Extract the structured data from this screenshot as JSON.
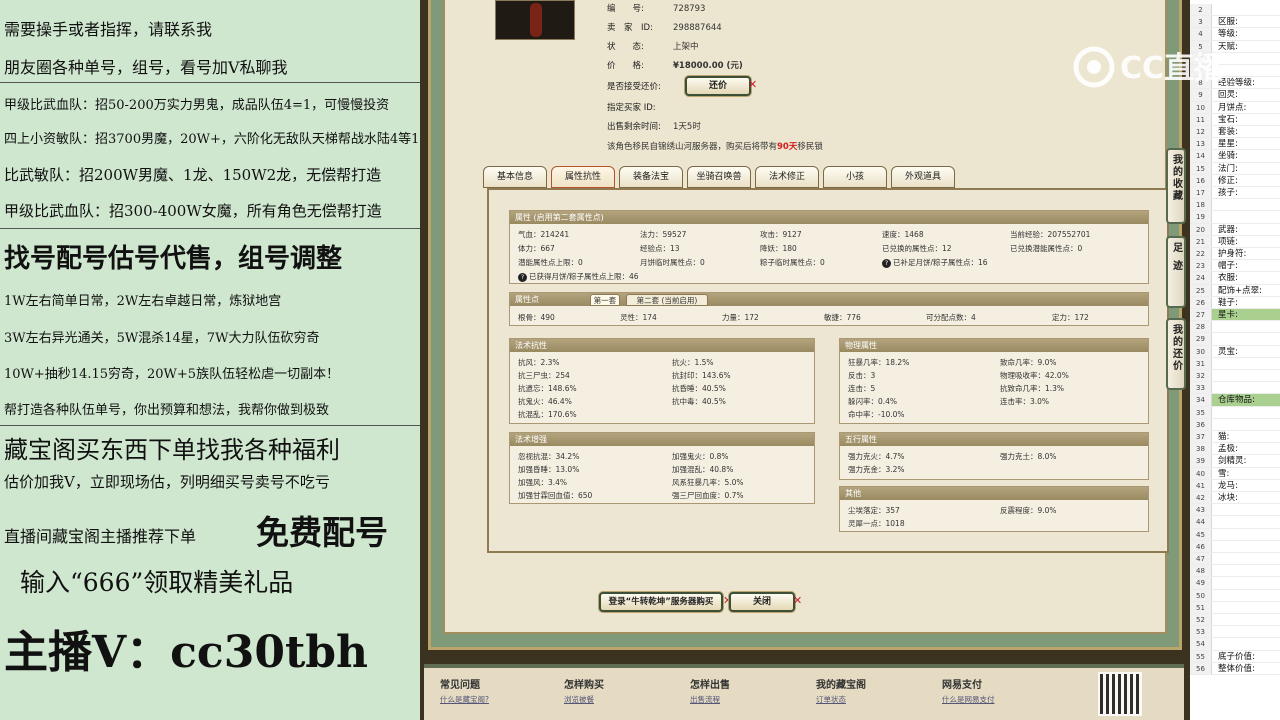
{
  "promo": {
    "lines": [
      "需要操手或者指挥，请联系我",
      "朋友圈各种单号，组号，看号加Ⅴ私聊我",
      "甲级比武血队：招50-200万实力男鬼，成品队伍4=1，可慢慢投资",
      "四上小资敏队：招3700男魔，20W+，六阶化无敌队天梯帮战水陆4等1",
      "比武敏队：招200W男魔、1龙、150W2龙，无偿帮打造",
      "甲级比武血队：招300-400W女魔，所有角色无偿帮打造",
      "找号配号估号代售，组号调整",
      "1W左右简单日常，2W左右卓越日常，炼狱地宫",
      "3W左右异光通关，5W混杀14星，7W大力队伍砍穷奇",
      "10W+抽秒14.15穷奇，20W+5族队伍轻松虐一切副本！",
      "帮打造各种队伍单号，你出预算和想法，我帮你做到极致",
      "藏宝阁买东西下单找我各种福利",
      "估价加我Ⅴ，立即现场估，列明细买号卖号不吃亏",
      "直播间藏宝阁主播推荐下单",
      "免费配号",
      "输入“666”领取精美礼品",
      "主播Ⅴ：cc30tbh"
    ]
  },
  "listing": {
    "rows": [
      {
        "label": "编　　号:",
        "value": "728793"
      },
      {
        "label": "卖　家　ID:",
        "value": "298887644"
      },
      {
        "label": "状　　态:",
        "value": "上架中"
      },
      {
        "label": "价　　格:",
        "value": "¥18000.00 (元)"
      },
      {
        "label": "是否接受还价:",
        "value": ""
      },
      {
        "label": "指定买家 ID:",
        "value": ""
      },
      {
        "label": "出售剩余时间:",
        "value": "1天5时"
      }
    ],
    "counter_offer_button": "还价",
    "notice_prefix": "该角色移民自锦绣山河服务器，购买后将带有",
    "notice_days": "90天",
    "notice_suffix": "移民锁"
  },
  "tabs": [
    "基本信息",
    "属性抗性",
    "装备法宝",
    "坐骑召唤兽",
    "法术修正",
    "小孩",
    "外观道具"
  ],
  "attrs": {
    "title": "属性 (启用第二套属性点)",
    "cells": [
      "气血：214241",
      "法力：59527",
      "攻击：9127",
      "速度：1468",
      "当前经验：207552701",
      "体力：667",
      "经验点：13",
      "降妖：180",
      "已兑换的属性点：12",
      "已兑换潜能属性点：0",
      "潜能属性点上限：0",
      "月饼临时属性点：0",
      "粽子临时属性点：0",
      "已补足月饼/粽子属性点：16",
      "已获得月饼/粽子属性点上限：46"
    ]
  },
  "points": {
    "title": "属性点",
    "tab1": "第一套",
    "tab2": "第二套 (当前启用)",
    "cells": [
      "根骨：490",
      "灵性：174",
      "力量：172",
      "敏捷：776",
      "可分配点数：4",
      "定力：172"
    ]
  },
  "resist": {
    "title": "法术抗性",
    "cells": [
      "抗风：2.3%",
      "抗火：1.5%",
      "抗三尸虫：254",
      "抗封印：143.6%",
      "抗遗忘：148.6%",
      "抗昏睡：40.5%",
      "抗鬼火：46.4%",
      "抗中毒：40.5%",
      "抗混乱：170.6%"
    ]
  },
  "enhance": {
    "title": "法术增强",
    "cells": [
      "忽视抗混：34.2%",
      "加强鬼火：0.8%",
      "加强昏睡：13.0%",
      "加强混乱：40.8%",
      "加强风：3.4%",
      "风系狂暴几率：5.0%",
      "加强甘霖回血值：650",
      "强三尸回血度：0.7%"
    ]
  },
  "physical": {
    "title": "物理属性",
    "cells": [
      "狂暴几率：18.2%",
      "致命几率：9.0%",
      "反击：3",
      "物理吸收率：42.0%",
      "连击：5",
      "抗致命几率：1.3%",
      "躲闪率：0.4%",
      "连击率：3.0%",
      "命中率：-10.0%"
    ]
  },
  "wuxing": {
    "title": "五行属性",
    "cells": [
      "强力克火：4.7%",
      "强力克土：8.0%",
      "强力克金：3.2%"
    ]
  },
  "other": {
    "title": "其他",
    "cells": [
      "尘埃落定：357",
      "反震程度：9.0%",
      "灵犀一点：1018"
    ]
  },
  "actions": {
    "buy": "登录“牛转乾坤”服务器购买",
    "close": "关闭"
  },
  "side_tabs": [
    "我的收藏",
    "足迹",
    "我的还价"
  ],
  "footer": {
    "cols": [
      {
        "title": "常见问题",
        "link": "什么是藏宝阁?"
      },
      {
        "title": "怎样购买",
        "link": "浏览被餐"
      },
      {
        "title": "怎样出售",
        "link": "出售流程"
      },
      {
        "title": "我的藏宝阁",
        "link": "订单状态"
      },
      {
        "title": "网易支付",
        "link": "什么是网易支付"
      }
    ]
  },
  "watermark": "CC直播",
  "sheet": {
    "rows": [
      {
        "n": "2",
        "v": ""
      },
      {
        "n": "3",
        "v": "区服:"
      },
      {
        "n": "4",
        "v": "等级:"
      },
      {
        "n": "5",
        "v": "天赋:"
      },
      {
        "n": "6",
        "v": ""
      },
      {
        "n": "7",
        "v": ""
      },
      {
        "n": "8",
        "v": "经验等级:"
      },
      {
        "n": "9",
        "v": "回灵:"
      },
      {
        "n": "10",
        "v": "月饼点:"
      },
      {
        "n": "11",
        "v": "宝石:"
      },
      {
        "n": "12",
        "v": "套装:"
      },
      {
        "n": "13",
        "v": "星星:"
      },
      {
        "n": "14",
        "v": "坐骑:"
      },
      {
        "n": "15",
        "v": "法门:"
      },
      {
        "n": "16",
        "v": "修正:"
      },
      {
        "n": "17",
        "v": "孩子:"
      },
      {
        "n": "18",
        "v": ""
      },
      {
        "n": "19",
        "v": ""
      },
      {
        "n": "20",
        "v": "武器:"
      },
      {
        "n": "21",
        "v": "项链:"
      },
      {
        "n": "22",
        "v": "护身符:"
      },
      {
        "n": "23",
        "v": "帽子:"
      },
      {
        "n": "24",
        "v": "衣服:"
      },
      {
        "n": "25",
        "v": "配饰+点翠:"
      },
      {
        "n": "26",
        "v": "鞋子:"
      },
      {
        "n": "27",
        "v": "星卡:",
        "hl": true
      },
      {
        "n": "28",
        "v": ""
      },
      {
        "n": "29",
        "v": ""
      },
      {
        "n": "30",
        "v": "灵宝:"
      },
      {
        "n": "31",
        "v": ""
      },
      {
        "n": "32",
        "v": ""
      },
      {
        "n": "33",
        "v": ""
      },
      {
        "n": "34",
        "v": "仓库物品:",
        "hl": true
      },
      {
        "n": "35",
        "v": ""
      },
      {
        "n": "36",
        "v": ""
      },
      {
        "n": "37",
        "v": "猫:"
      },
      {
        "n": "38",
        "v": "孟极:"
      },
      {
        "n": "39",
        "v": "剑精灵:"
      },
      {
        "n": "40",
        "v": "雪:"
      },
      {
        "n": "41",
        "v": "龙马:"
      },
      {
        "n": "42",
        "v": "冰块:"
      },
      {
        "n": "43",
        "v": ""
      },
      {
        "n": "44",
        "v": ""
      },
      {
        "n": "45",
        "v": ""
      },
      {
        "n": "46",
        "v": ""
      },
      {
        "n": "47",
        "v": ""
      },
      {
        "n": "48",
        "v": ""
      },
      {
        "n": "49",
        "v": ""
      },
      {
        "n": "50",
        "v": ""
      },
      {
        "n": "51",
        "v": ""
      },
      {
        "n": "52",
        "v": ""
      },
      {
        "n": "53",
        "v": ""
      },
      {
        "n": "54",
        "v": ""
      },
      {
        "n": "55",
        "v": "底子价值:"
      },
      {
        "n": "56",
        "v": "整体价值:"
      }
    ]
  }
}
